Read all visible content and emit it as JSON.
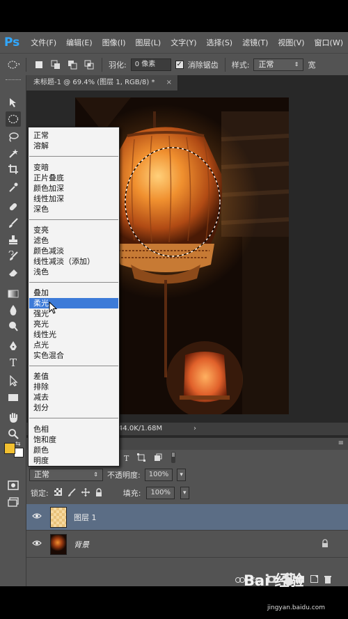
{
  "app": {
    "logo": "Ps"
  },
  "menu": [
    "文件(F)",
    "编辑(E)",
    "图像(I)",
    "图层(L)",
    "文字(Y)",
    "选择(S)",
    "滤镜(T)",
    "视图(V)",
    "窗口(W)"
  ],
  "options": {
    "feather_label": "羽化:",
    "feather_value": "0 像素",
    "antialias_label": "消除锯齿",
    "antialias_checked": true,
    "style_label": "样式:",
    "style_value": "正常",
    "more": "宽"
  },
  "document": {
    "tab_title": "未标题-1 @ 69.4% (图层 1, RGB/8) *",
    "close": "×",
    "status": "44.0K/1.68M"
  },
  "layers_panel": {
    "blend_mode": "正常",
    "opacity_label": "不透明度:",
    "opacity_value": "100%",
    "lock_label": "锁定:",
    "fill_label": "填充:",
    "fill_value": "100%",
    "layers": [
      {
        "name": "图层 1",
        "selected": true,
        "visible": true
      },
      {
        "name": "背景",
        "selected": false,
        "visible": true,
        "locked": true
      }
    ],
    "footer_icons": [
      "link-icon",
      "fx-icon",
      "mask-icon",
      "adjustment-icon",
      "group-icon",
      "new-layer-icon",
      "trash-icon"
    ],
    "footer_fx": "fx."
  },
  "blend_menu": {
    "groups": [
      [
        "正常",
        "溶解"
      ],
      [
        "变暗",
        "正片叠底",
        "颜色加深",
        "线性加深",
        "深色"
      ],
      [
        "变亮",
        "滤色",
        "颜色减淡",
        "线性减淡（添加）",
        "浅色"
      ],
      [
        "叠加",
        "柔光",
        "强光",
        "亮光",
        "线性光",
        "点光",
        "实色混合"
      ],
      [
        "差值",
        "排除",
        "减去",
        "划分"
      ],
      [
        "色相",
        "饱和度",
        "颜色",
        "明度"
      ]
    ],
    "highlighted": "柔光"
  },
  "watermark": {
    "main": "Bai 经验",
    "sub": "jingyan.baidu.com"
  },
  "colors": {
    "accent": "#31a8ff",
    "highlight": "#3d7bd8",
    "selected_layer": "#5b6d85",
    "foreground": "#f2c030",
    "background": "#ffffff"
  }
}
